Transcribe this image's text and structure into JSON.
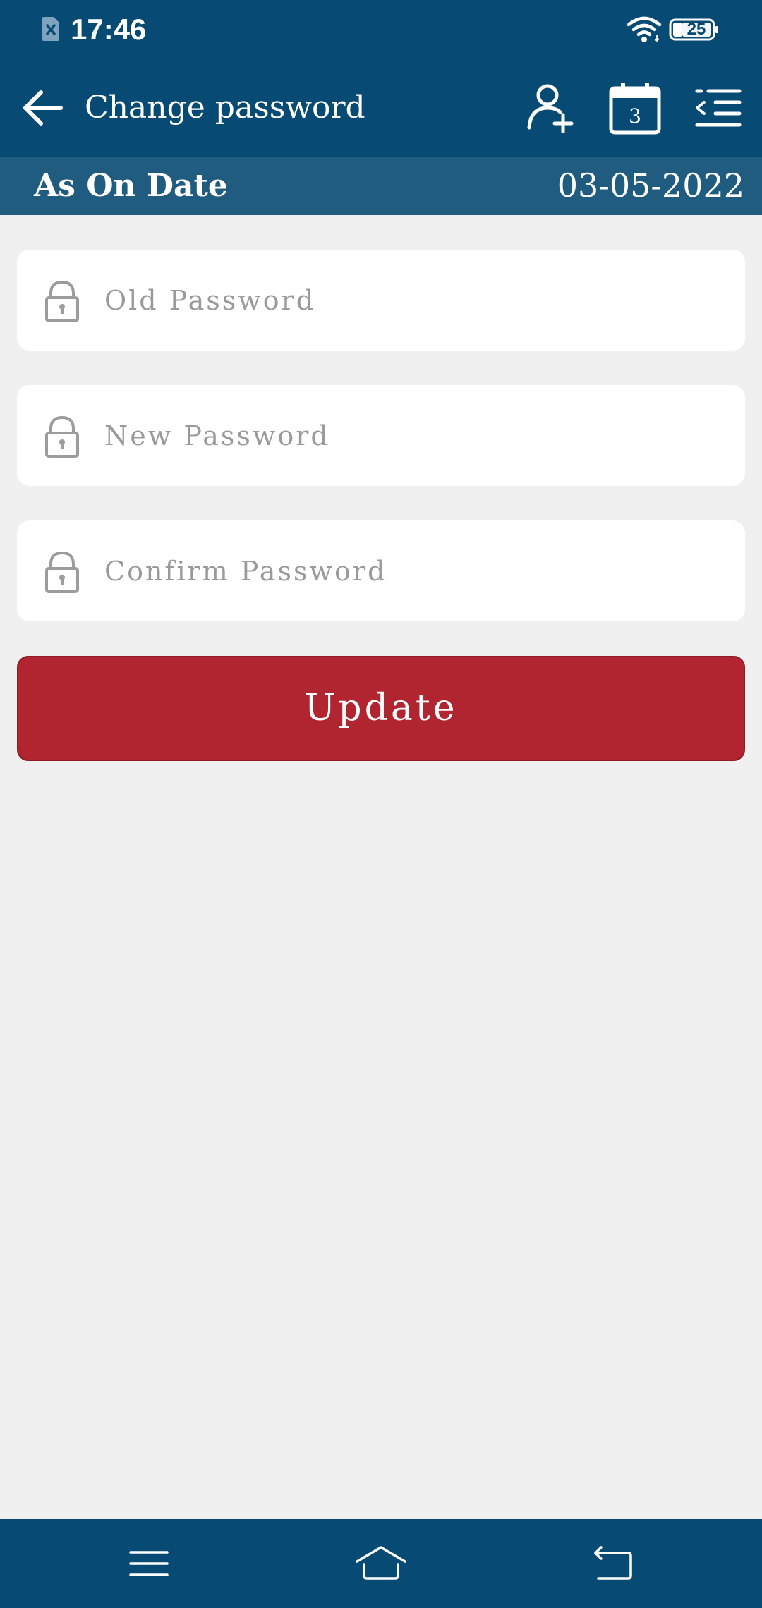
{
  "status_bar": {
    "time": "17:46",
    "battery": "25",
    "icons": [
      "sim-error-icon",
      "wifi-icon",
      "battery-icon"
    ]
  },
  "app_bar": {
    "title": "Change password",
    "icons": [
      "back-arrow-icon",
      "add-user-icon",
      "calendar-icon",
      "menu-collapse-icon"
    ],
    "calendar_day": "3"
  },
  "date_bar": {
    "label": "As On Date",
    "value": "03-05-2022"
  },
  "form": {
    "old_password": {
      "placeholder": "Old Password",
      "value": "",
      "icon": "lock-icon"
    },
    "new_password": {
      "placeholder": "New Password",
      "value": "",
      "icon": "lock-icon"
    },
    "confirm_password": {
      "placeholder": "Confirm Password",
      "value": "",
      "icon": "lock-icon"
    },
    "update_label": "Update"
  },
  "nav_bar": {
    "icons": [
      "recents-icon",
      "home-icon",
      "back-icon"
    ]
  },
  "colors": {
    "header": "#074a74",
    "date_bar": "#1f5c80",
    "background": "#f0f0f0",
    "button": "#b02530",
    "placeholder": "#9a9a9a"
  }
}
